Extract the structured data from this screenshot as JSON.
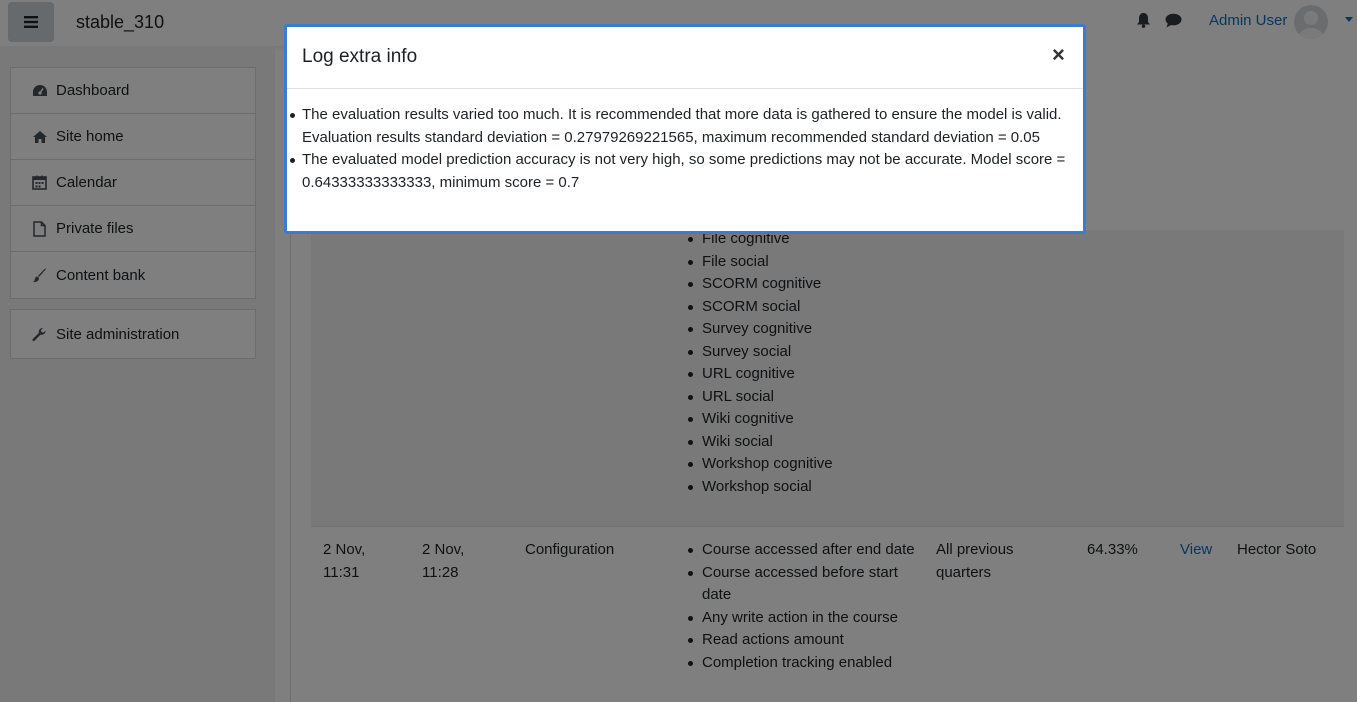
{
  "header": {
    "site_name": "stable_310",
    "user_name": "Admin User",
    "icons": [
      "menu-icon",
      "bell-icon",
      "chat-icon",
      "user-avatar"
    ]
  },
  "sidebar": {
    "items": [
      {
        "label": "Dashboard",
        "icon": "dashboard-icon"
      },
      {
        "label": "Site home",
        "icon": "home-icon"
      },
      {
        "label": "Calendar",
        "icon": "calendar-icon"
      },
      {
        "label": "Private files",
        "icon": "file-icon"
      },
      {
        "label": "Content bank",
        "icon": "brush-icon"
      }
    ],
    "admin": {
      "label": "Site administration",
      "icon": "wrench-icon"
    }
  },
  "table": {
    "row1_indicators": [
      "File cognitive",
      "File social",
      "SCORM cognitive",
      "SCORM social",
      "Survey cognitive",
      "Survey social",
      "URL cognitive",
      "URL social",
      "Wiki cognitive",
      "Wiki social",
      "Workshop cognitive",
      "Workshop social"
    ],
    "row2": {
      "date1_line1": "2 Nov,",
      "date1_line2": "11:31",
      "date2_line1": "2 Nov,",
      "date2_line2": "11:28",
      "type": "Configuration",
      "indicators": [
        "Course accessed after end date",
        "Course accessed before start date",
        "Any write action in the course",
        "Read actions amount",
        "Completion tracking enabled"
      ],
      "period": "All previous quarters",
      "score": "64.33%",
      "action": "View",
      "user": "Hector Soto"
    }
  },
  "modal": {
    "title": "Log extra info",
    "close": "×",
    "messages": [
      "The evaluation results varied too much. It is recommended that more data is gathered to ensure the model is valid. Evaluation results standard deviation = 0.27979269221565, maximum recommended standard deviation = 0.05",
      "The evaluated model prediction accuracy is not very high, so some predictions may not be accurate. Model score = 0.64333333333333, minimum score = 0.7"
    ]
  }
}
